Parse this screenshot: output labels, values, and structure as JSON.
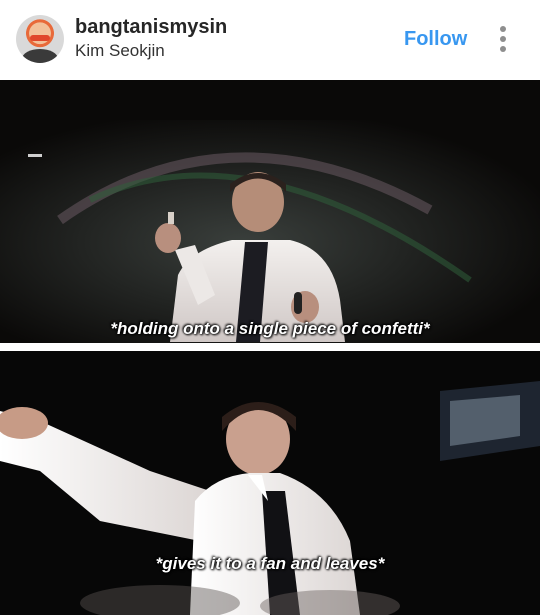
{
  "header": {
    "username": "bangtanismysin",
    "subtitle": "Kim Seokjin",
    "follow_label": "Follow",
    "more_icon": "more-vertical-icon"
  },
  "panels": [
    {
      "caption": "*holding onto a single piece of confetti*"
    },
    {
      "caption": "*gives it to a fan and leaves*"
    }
  ],
  "colors": {
    "follow": "#3897f0",
    "text": "#262626",
    "photo_background": "#0a0908"
  }
}
